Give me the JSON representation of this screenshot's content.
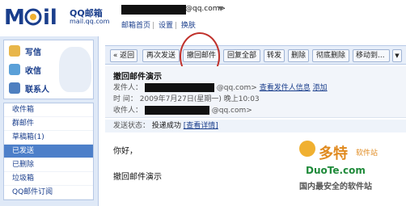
{
  "header": {
    "logo_text": "QQ邮箱",
    "logo_sub": "mail.qq.com",
    "account_suffix": "@qq.com>",
    "links": [
      "邮箱首页",
      "设置",
      "换肤"
    ]
  },
  "sidebar": {
    "big": [
      "写信",
      "收信",
      "联系人"
    ],
    "folders": [
      "收件箱",
      "群邮件",
      "草稿箱(1)",
      "已发送",
      "已删除",
      "垃圾箱",
      "QQ邮件订阅"
    ],
    "active": "已发送"
  },
  "toolbar": {
    "buttons": [
      "« 返回",
      "再次发送",
      "撤回邮件",
      "回复全部",
      "转发",
      "删除",
      "彻底删除",
      "移动到..."
    ]
  },
  "message": {
    "subject": "撤回邮件演示",
    "from_label": "发件人：",
    "from_suffix": "@qq.com>",
    "from_link1": "查看发件人信息",
    "from_link2": "添加",
    "time_label": "时  间：",
    "time_value": "2009年7月27日(星期一) 晚上10:03",
    "to_label": "收件人：",
    "to_suffix": "@qq.com>",
    "status_label": "发送状态：",
    "status_value": "投递成功",
    "status_link": "[查看详情]",
    "body_line1": "你好，",
    "body_line2": "撤回邮件演示"
  },
  "watermark": {
    "brand": "多特",
    "brand_small": "软件站",
    "url": "DuoTe.com",
    "slogan": "国内最安全的软件站"
  },
  "colors": {
    "accent": "#1a3e8c",
    "sidebar_bg": "#dfe9f7",
    "active_bg": "#4d7fc9",
    "highlight_circle": "#c0312b"
  }
}
